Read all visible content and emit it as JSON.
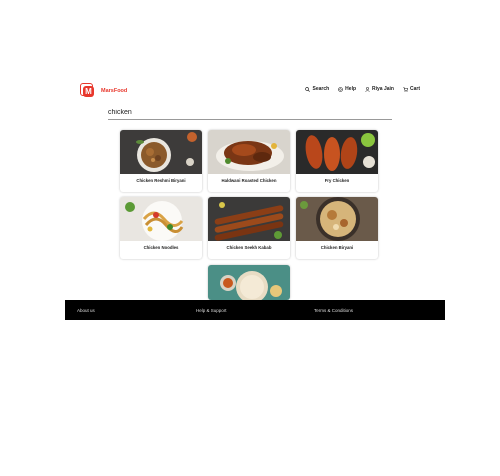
{
  "brand": {
    "name": "MarsFood",
    "logo_letter": "M"
  },
  "nav": [
    {
      "label": "Search",
      "icon": "search-icon"
    },
    {
      "label": "Help",
      "icon": "help-icon"
    },
    {
      "label": "Riya Jain",
      "icon": "user-icon"
    },
    {
      "label": "Cart",
      "icon": "cart-icon"
    }
  ],
  "search": {
    "value": "chicken"
  },
  "results": [
    {
      "name": "Chicken Reshmi Biryani"
    },
    {
      "name": "Haldwani Roasted Chicken"
    },
    {
      "name": "Fry Chicken"
    },
    {
      "name": "Chicken Noodles"
    },
    {
      "name": "Chicken Seekh Kabab"
    },
    {
      "name": "Chicken Biryani"
    },
    {
      "name": ""
    }
  ],
  "footer": {
    "about": "About us",
    "help": "Help & Support",
    "terms": "Terms & Conditions"
  },
  "colors": {
    "accent": "#e8372c",
    "footer_bg": "#000000"
  }
}
